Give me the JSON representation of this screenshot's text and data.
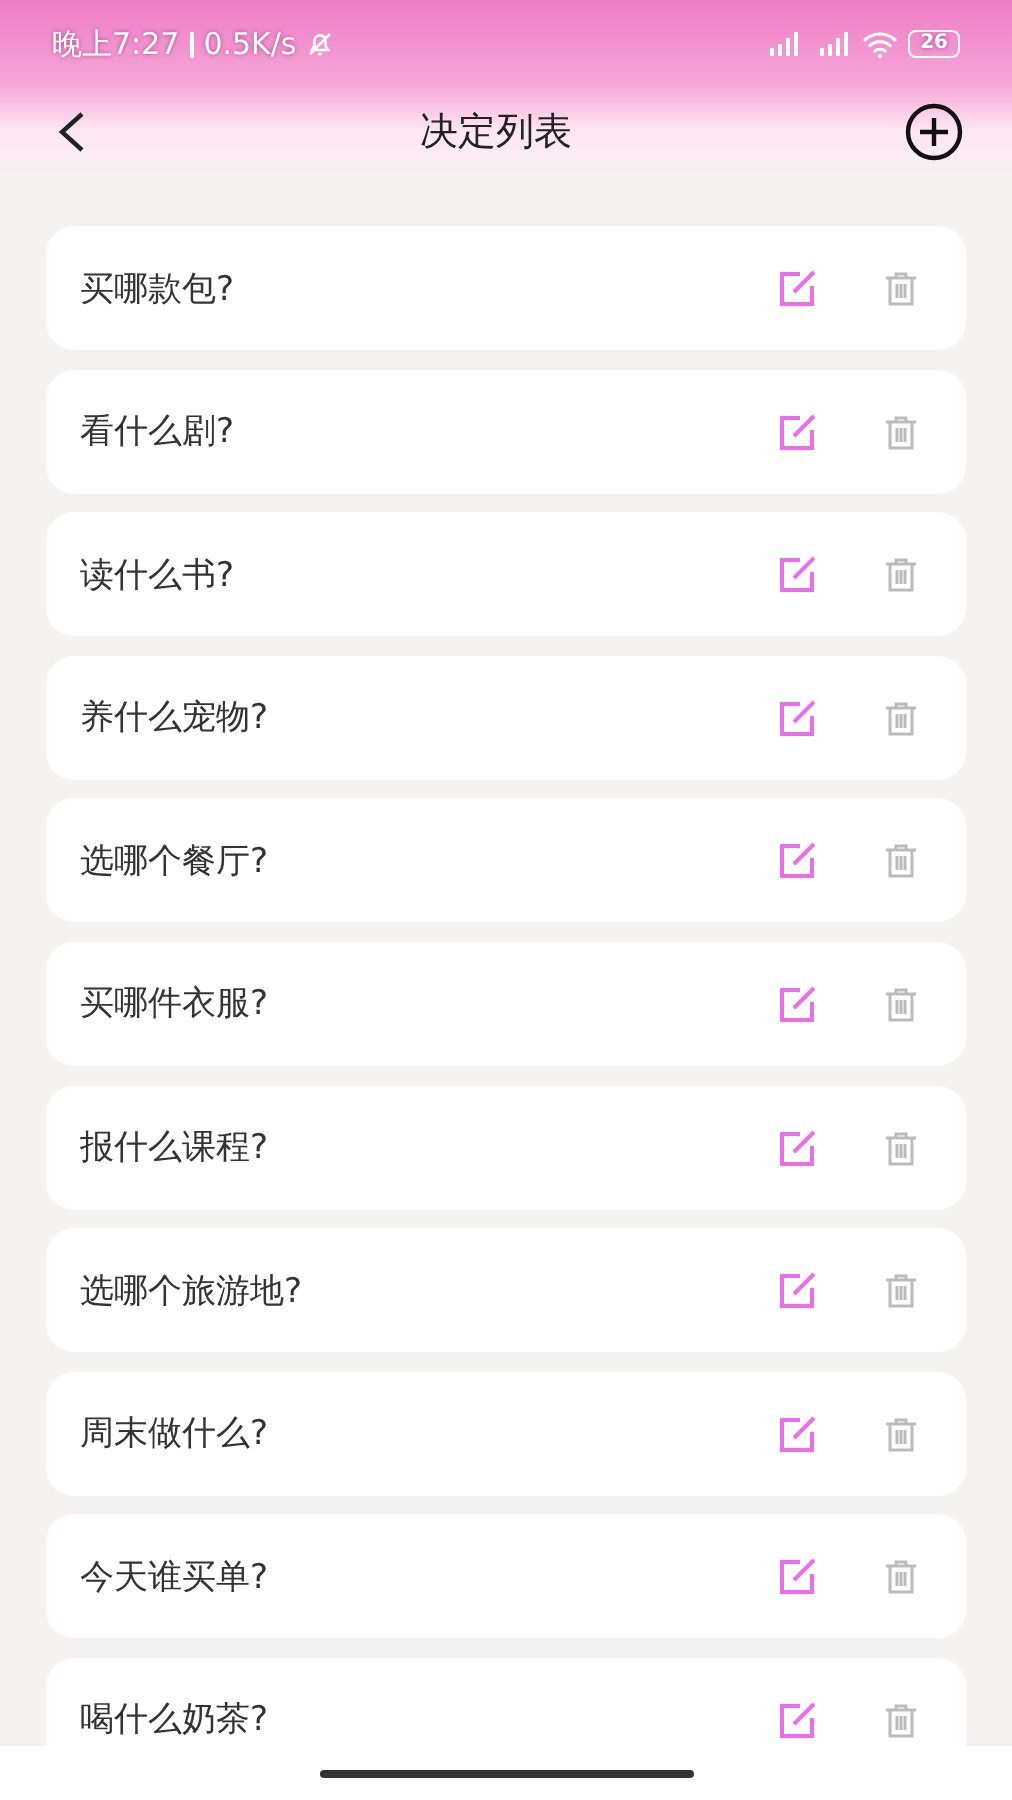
{
  "status_bar": {
    "time": "晚上7:27",
    "speed": "0.5K/s",
    "battery": "26"
  },
  "header": {
    "title": "决定列表"
  },
  "items": [
    {
      "title": "买哪款包?"
    },
    {
      "title": "看什么剧?"
    },
    {
      "title": "读什么书?"
    },
    {
      "title": "养什么宠物?"
    },
    {
      "title": "选哪个餐厅?"
    },
    {
      "title": "买哪件衣服?"
    },
    {
      "title": "报什么课程?"
    },
    {
      "title": "选哪个旅游地?"
    },
    {
      "title": "周末做什么?"
    },
    {
      "title": "今天谁买单?"
    },
    {
      "title": "喝什么奶茶?"
    }
  ]
}
